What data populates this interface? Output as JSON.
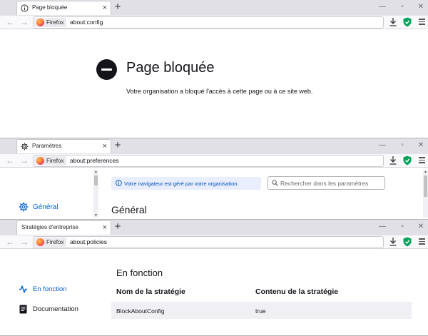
{
  "browser": {
    "identity_label": "Firefox"
  },
  "windows": [
    {
      "tab_title": "Page bloquée",
      "url": "about:config",
      "page": {
        "title": "Page bloquée",
        "description": "Votre organisation a bloqué l'accès à cette page ou à ce site web."
      }
    },
    {
      "tab_title": "Paramètres",
      "url": "about:preferences",
      "page": {
        "sidebar_item": "Général",
        "policy_notice": "Votre navigateur est géré par votre organisation.",
        "search_placeholder": "Rechercher dans les paramètres",
        "heading": "Général"
      }
    },
    {
      "tab_title": "Stratégies d'entreprise",
      "url": "about:policies",
      "page": {
        "sidebar_active": "En fonction",
        "sidebar_docs": "Documentation",
        "heading": "En fonction",
        "columns": [
          "Nom de la stratégie",
          "Contenu de la stratégie"
        ],
        "rows": [
          [
            "BlockAboutConfig",
            "true"
          ]
        ]
      }
    }
  ]
}
